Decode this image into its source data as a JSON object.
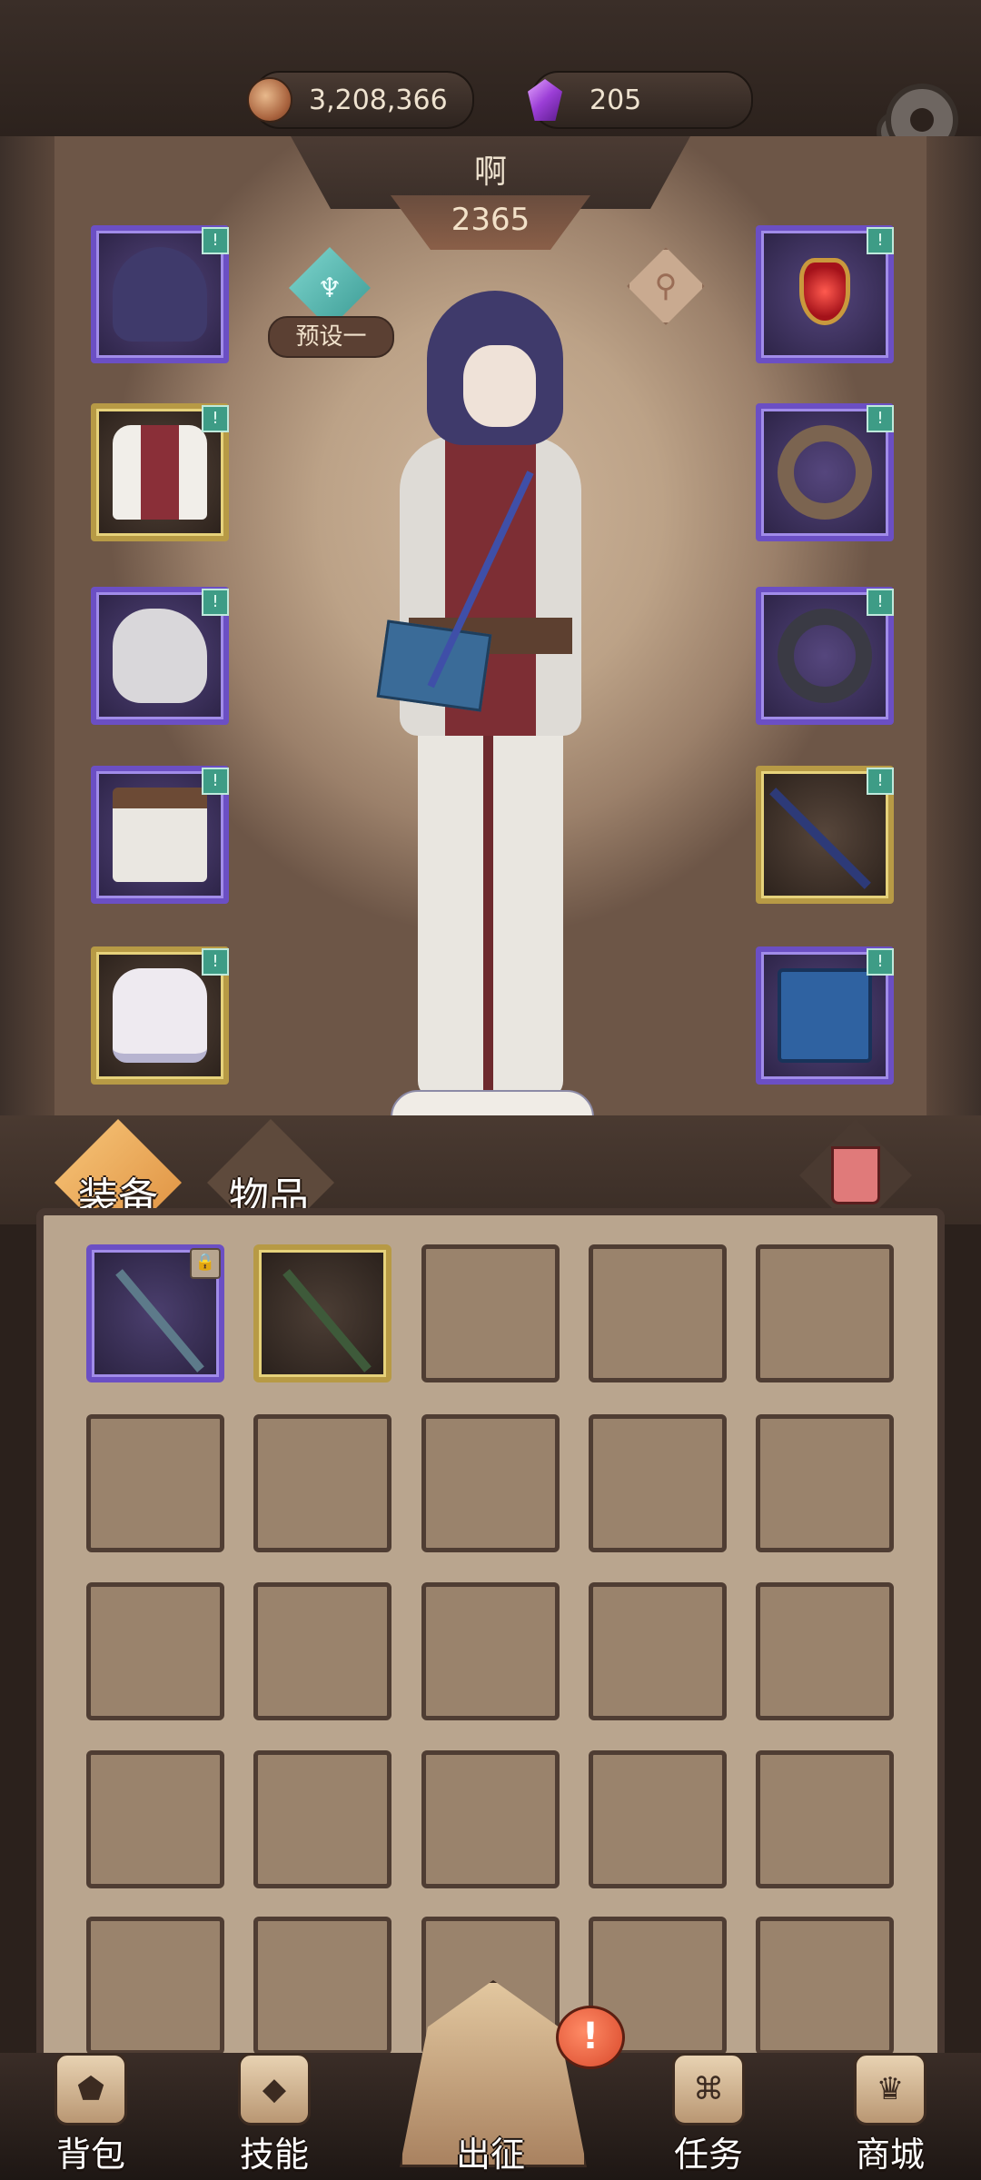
{
  "currency": {
    "coins": "3,208,366",
    "coin_icon": "copper-coin-icon",
    "gems": "205",
    "gem_icon": "purple-crystal-icon"
  },
  "settings_icon": "gear-icon",
  "character": {
    "name": "啊",
    "power": "2365",
    "preset_label": "预设一"
  },
  "equipment": {
    "left": [
      {
        "name": "hood",
        "badge": "!",
        "rarity": "rare"
      },
      {
        "name": "shirt",
        "badge": "!",
        "rarity": "legend"
      },
      {
        "name": "glove",
        "badge": "!",
        "rarity": "rare"
      },
      {
        "name": "pants",
        "badge": "!",
        "rarity": "rare"
      },
      {
        "name": "boots",
        "badge": "!",
        "rarity": "legend"
      }
    ],
    "right": [
      {
        "name": "amulet",
        "badge": "!",
        "rarity": "rare"
      },
      {
        "name": "bracelet",
        "badge": "!",
        "rarity": "rare"
      },
      {
        "name": "ring",
        "badge": "!",
        "rarity": "rare"
      },
      {
        "name": "staff",
        "badge": "!",
        "rarity": "legend"
      },
      {
        "name": "tome",
        "badge": "!",
        "rarity": "rare"
      }
    ]
  },
  "inventory_tabs": {
    "equipment": "装备",
    "items": "物品"
  },
  "nav": {
    "backpack": "背包",
    "skills": "技能",
    "expedition": "出征",
    "quests": "任务",
    "shop": "商城",
    "alert": "!"
  },
  "colors": {
    "rare_border": "#6b4fc4",
    "legend_border": "#b79a45",
    "badge": "#3e9c86",
    "active_tab": "#f0a54f"
  }
}
